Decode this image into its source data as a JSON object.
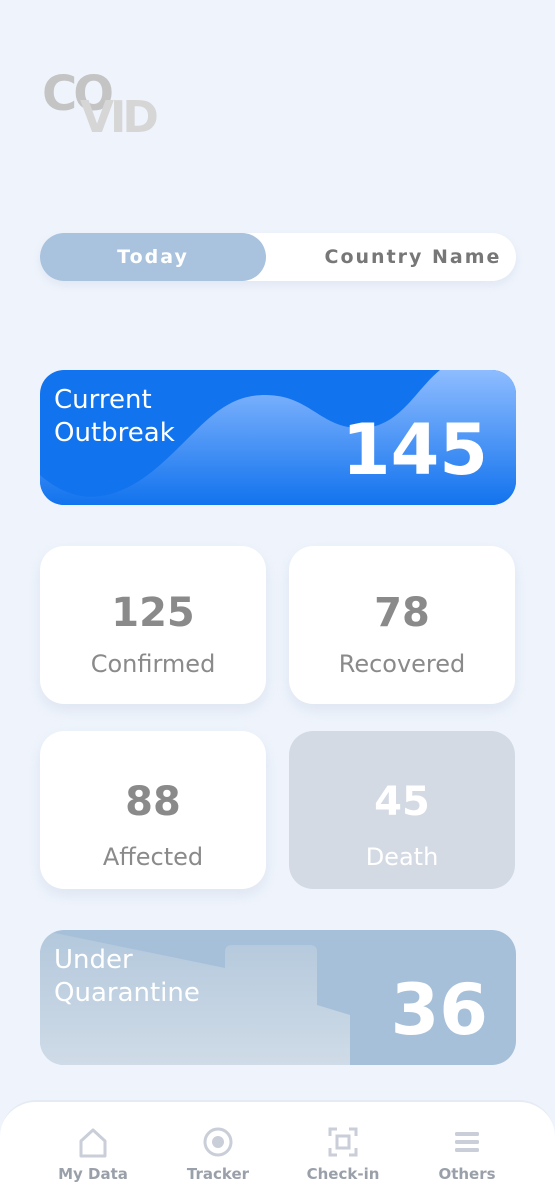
{
  "logo": {
    "line1": "CO",
    "line2": "VID"
  },
  "segmented": {
    "active": "Today",
    "inactive": "Country Name"
  },
  "outbreak": {
    "label_line1": "Current",
    "label_line2": "Outbreak",
    "value": "145"
  },
  "stats": [
    {
      "value": "125",
      "label": "Confirmed"
    },
    {
      "value": "78",
      "label": "Recovered"
    },
    {
      "value": "88",
      "label": "Affected"
    },
    {
      "value": "45",
      "label": "Death"
    }
  ],
  "quarantine": {
    "label_line1": "Under",
    "label_line2": "Quarantine",
    "value": "36"
  },
  "nav": [
    {
      "label": "My Data",
      "icon": "home-icon"
    },
    {
      "label": "Tracker",
      "icon": "target-icon"
    },
    {
      "label": "Check-in",
      "icon": "scan-icon"
    },
    {
      "label": "Others",
      "icon": "menu-icon"
    }
  ],
  "colors": {
    "background": "#eff4fc",
    "accent": "#1273ee",
    "muted": "#a9c2dd"
  }
}
